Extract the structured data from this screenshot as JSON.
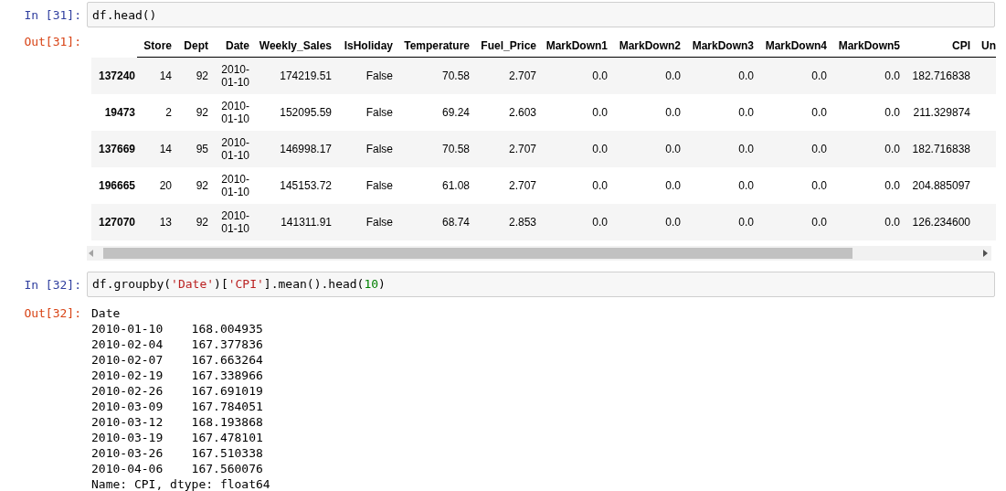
{
  "cells": [
    {
      "in_prompt": "In [31]:",
      "code": [
        {
          "kind": "plain",
          "text": "df.head()"
        }
      ],
      "out_prompt": "Out[31]:",
      "output": {
        "kind": "table",
        "columns": [
          "Store",
          "Dept",
          "Date",
          "Weekly_Sales",
          "IsHoliday",
          "Temperature",
          "Fuel_Price",
          "MarkDown1",
          "MarkDown2",
          "MarkDown3",
          "MarkDown4",
          "MarkDown5",
          "CPI",
          "Un"
        ],
        "rows": [
          {
            "index": "137240",
            "cells": [
              "14",
              "92",
              "2010-01-10",
              "174219.51",
              "False",
              "70.58",
              "2.707",
              "0.0",
              "0.0",
              "0.0",
              "0.0",
              "0.0",
              "182.716838"
            ]
          },
          {
            "index": "19473",
            "cells": [
              "2",
              "92",
              "2010-01-10",
              "152095.59",
              "False",
              "69.24",
              "2.603",
              "0.0",
              "0.0",
              "0.0",
              "0.0",
              "0.0",
              "211.329874"
            ]
          },
          {
            "index": "137669",
            "cells": [
              "14",
              "95",
              "2010-01-10",
              "146998.17",
              "False",
              "70.58",
              "2.707",
              "0.0",
              "0.0",
              "0.0",
              "0.0",
              "0.0",
              "182.716838"
            ]
          },
          {
            "index": "196665",
            "cells": [
              "20",
              "92",
              "2010-01-10",
              "145153.72",
              "False",
              "61.08",
              "2.707",
              "0.0",
              "0.0",
              "0.0",
              "0.0",
              "0.0",
              "204.885097"
            ]
          },
          {
            "index": "127070",
            "cells": [
              "13",
              "92",
              "2010-01-10",
              "141311.91",
              "False",
              "68.74",
              "2.853",
              "0.0",
              "0.0",
              "0.0",
              "0.0",
              "0.0",
              "126.234600"
            ]
          }
        ]
      }
    },
    {
      "in_prompt": "In [32]:",
      "code": [
        {
          "kind": "plain",
          "text": "df.groupby("
        },
        {
          "kind": "string",
          "text": "'Date'"
        },
        {
          "kind": "plain",
          "text": ")["
        },
        {
          "kind": "string",
          "text": "'CPI'"
        },
        {
          "kind": "plain",
          "text": "].mean().head("
        },
        {
          "kind": "number",
          "text": "10"
        },
        {
          "kind": "plain",
          "text": ")"
        }
      ],
      "out_prompt": "Out[32]:",
      "output": {
        "kind": "text",
        "lines": [
          "Date",
          "2010-01-10    168.004935",
          "2010-02-04    167.377836",
          "2010-02-07    167.663264",
          "2010-02-19    167.338966",
          "2010-02-26    167.691019",
          "2010-03-09    167.784051",
          "2010-03-12    168.193868",
          "2010-03-19    167.478101",
          "2010-03-26    167.510338",
          "2010-04-06    167.560076",
          "Name: CPI, dtype: float64"
        ]
      }
    }
  ]
}
